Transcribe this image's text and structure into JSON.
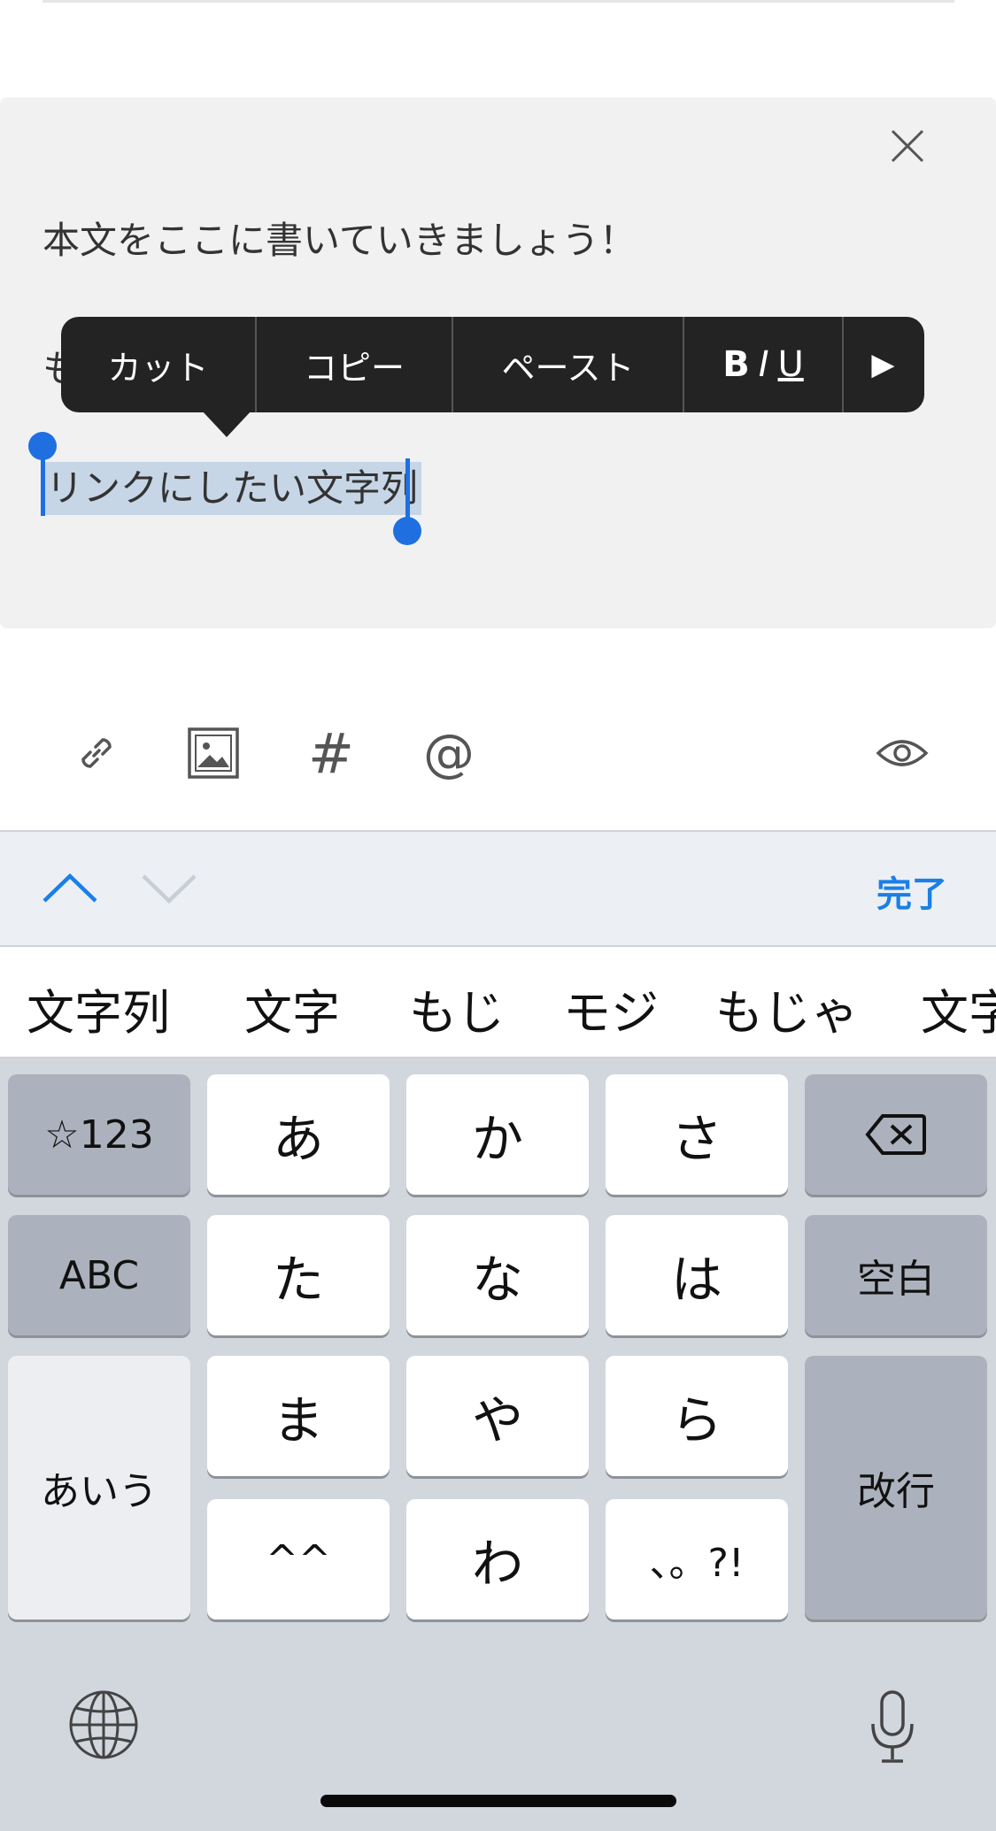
{
  "editor": {
    "body_line1": "本文をここに書いていきましょう！",
    "body_line2": "も",
    "selected_text": "リンクにしたい文字列"
  },
  "context_menu": {
    "cut": "カット",
    "copy": "コピー",
    "paste": "ペースト",
    "bold": "B",
    "italic": "I",
    "underline": "U",
    "more": "▶"
  },
  "toolbar": {
    "hash": "#",
    "at": "@"
  },
  "accessory": {
    "done_label": "完了"
  },
  "candidates": [
    "文字列",
    "文字",
    "もじ",
    "モジ",
    "もじゃ",
    "文字"
  ],
  "keyboard": {
    "row1": [
      "☆123",
      "あ",
      "か",
      "さ"
    ],
    "row2": [
      "ABC",
      "た",
      "な",
      "は",
      "空白"
    ],
    "row3": [
      "あいう",
      "ま",
      "や",
      "ら",
      "改行"
    ],
    "row4": [
      "^^",
      "わ",
      "、。?!"
    ]
  },
  "icons": {
    "close": "close-icon",
    "link": "link-icon",
    "image": "image-icon",
    "eye": "eye-icon",
    "backspace": "backspace-icon",
    "globe": "globe-icon",
    "mic": "microphone-icon"
  },
  "colors": {
    "accent": "#1f6fe0",
    "done": "#1b7fe6",
    "selection": "#c6d6e6",
    "menu_bg": "#232323"
  }
}
